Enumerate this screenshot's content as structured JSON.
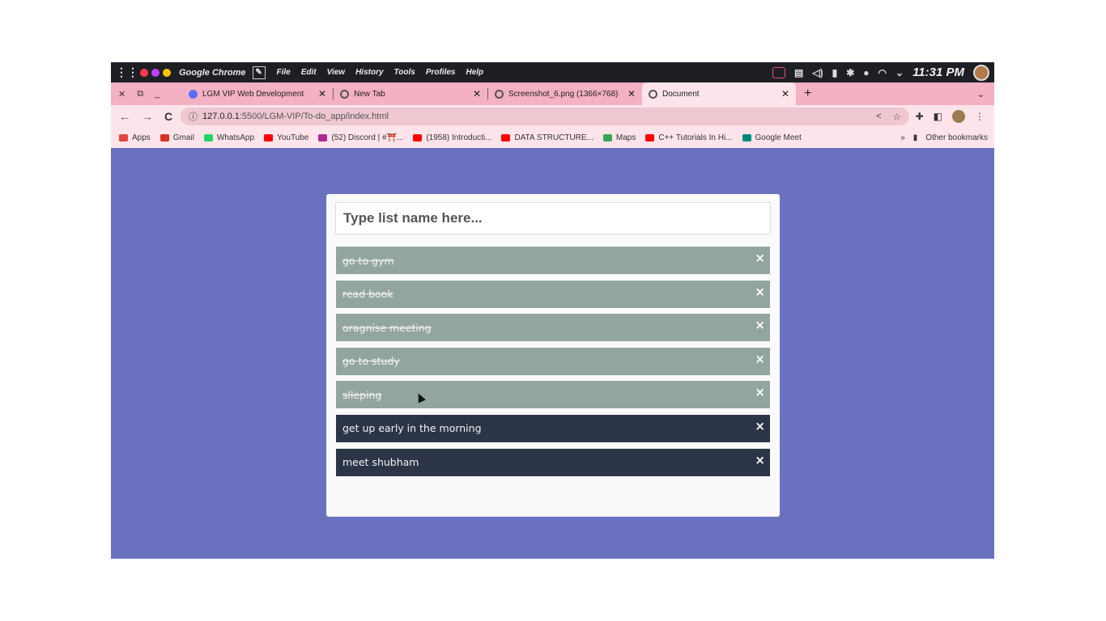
{
  "system": {
    "app_name": "Google Chrome",
    "menu": [
      "File",
      "Edit",
      "View",
      "History",
      "Tools",
      "Profiles",
      "Help"
    ],
    "time": "11:31 PM",
    "traffic_colors": [
      "#ff3b4e",
      "#c040ff",
      "#ffc400"
    ]
  },
  "tabs": [
    {
      "title": "LGM VIP Web Development",
      "icon": "globe-icon",
      "color": "#5b6cff"
    },
    {
      "title": "New Tab",
      "icon": "chrome-icon",
      "color": "#555555"
    },
    {
      "title": "Screenshot_6.png (1366×768)",
      "icon": "chrome-icon",
      "color": "#555555"
    },
    {
      "title": "Document",
      "icon": "chrome-icon",
      "color": "#555555",
      "active": true
    }
  ],
  "address": {
    "host": "127.0.0.1",
    "rest": ":5500/LGM-VIP/To-do_app/index.html"
  },
  "bookmarks": [
    {
      "label": "Apps",
      "color": "#e0443c"
    },
    {
      "label": "Gmail",
      "color": "#d93025"
    },
    {
      "label": "WhatsApp",
      "color": "#25d366"
    },
    {
      "label": "YouTube",
      "color": "#ff0000"
    },
    {
      "label": "(52) Discord | #⛩️...",
      "color": "#b02a90"
    },
    {
      "label": "(1958) Introducti...",
      "color": "#ff0000"
    },
    {
      "label": "DATA STRUCTURE...",
      "color": "#ff0000"
    },
    {
      "label": "Maps",
      "color": "#34a853"
    },
    {
      "label": "C++ Tutorials In Hi...",
      "color": "#ff0000"
    },
    {
      "label": "Google Meet",
      "color": "#00897b"
    }
  ],
  "bookmarks_more": "»",
  "other_bookmarks": "Other bookmarks",
  "todo": {
    "placeholder": "Type list name here...",
    "items": [
      {
        "text": "go to gym",
        "done": true
      },
      {
        "text": "read book",
        "done": true
      },
      {
        "text": "oragnise meeting",
        "done": true
      },
      {
        "text": "go to study",
        "done": true
      },
      {
        "text": "slleping",
        "done": true
      },
      {
        "text": "get up early in the morning",
        "done": false
      },
      {
        "text": "meet shubham",
        "done": false
      }
    ],
    "delete_label": "×"
  }
}
